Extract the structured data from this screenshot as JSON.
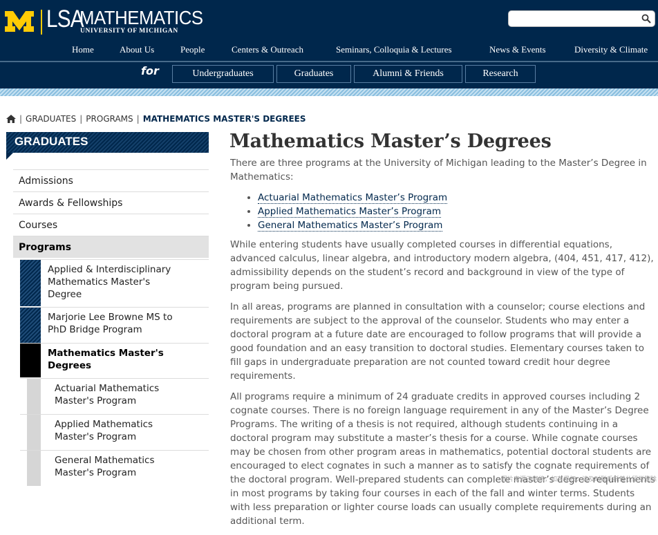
{
  "brand": {
    "lsa": "LSA",
    "math": "MATHEMATICS",
    "university": "UNIVERSITY OF MICHIGAN",
    "colors": {
      "navy": "#00274c",
      "maize": "#ffcb05",
      "stripe": "#89bedf"
    }
  },
  "search": {
    "placeholder": "",
    "value": ""
  },
  "main_nav": [
    "Home",
    "About Us",
    "People",
    "Centers & Outreach",
    "Seminars, Colloquia & Lectures",
    "News & Events",
    "Diversity & Climate"
  ],
  "audience": {
    "for_label": "for",
    "buttons": [
      "Undergraduates",
      "Graduates",
      "Alumni & Friends",
      "Research"
    ]
  },
  "breadcrumb": {
    "items": [
      "GRADUATES",
      "PROGRAMS"
    ],
    "current": "MATHEMATICS MASTER'S DEGREES"
  },
  "sidebar": {
    "title": "GRADUATES",
    "items": [
      "Admissions",
      "Awards & Fellowships",
      "Courses",
      "Programs"
    ],
    "sub_items": [
      "Applied & Interdisciplinary Mathematics Master's Degree",
      "Marjorie Lee Browne MS to PhD Bridge Program",
      "Mathematics Master's Degrees"
    ],
    "deep_items": [
      "Actuarial Mathematics Master's Program",
      "Applied Mathematics Master's Program",
      "General Mathematics Master's Program"
    ]
  },
  "content": {
    "title": "Mathematics Master’s Degrees",
    "intro": "There are three programs at the University of Michigan leading to the Master’s Degree in Mathematics:",
    "links": [
      "Actuarial Mathematics Master’s Program",
      "Applied Mathematics Master’s Program",
      "General Mathematics Master’s Program"
    ],
    "paragraphs": [
      "While entering students have usually completed courses in differential equations, advanced calculus, linear algebra, and introductory modern algebra, (404, 451, 417, 412), admissibility depends on the student’s record and background in view of the type of program being pursued.",
      "In all areas, programs are planned in consultation with a counselor; course elections and requirements are subject to the approval of the counselor. Students who may enter a doctoral program at a future date are encouraged to follow programs that will provide a good foundation and an easy transition to doctoral studies. Elementary courses taken to fill gaps in undergraduate preparation are not counted toward credit hour degree requirements.",
      "All programs require a minimum of 24 graduate credits in approved courses including 2 cognate courses. There is no foreign language requirement in any of the Master’s Degree Programs. The writing of a thesis is not required, although students continuing in a doctoral program may substitute a master’s thesis for a course. While cognate courses may be chosen from other program areas in mathematics, potential doctoral students are encouraged to elect cognates in such a manner as to satisfy the cognate requirements of the doctoral program. Well-prepared students can complete master’s degree requirements in most programs by taking four courses in each of the fall and winter terms. Students with less preparation or lighter course loads can usually complete requirements during an additional term."
    ]
  },
  "watermark": "图片来源于网络，如有侵权，请及时联系托普仕留学删除"
}
